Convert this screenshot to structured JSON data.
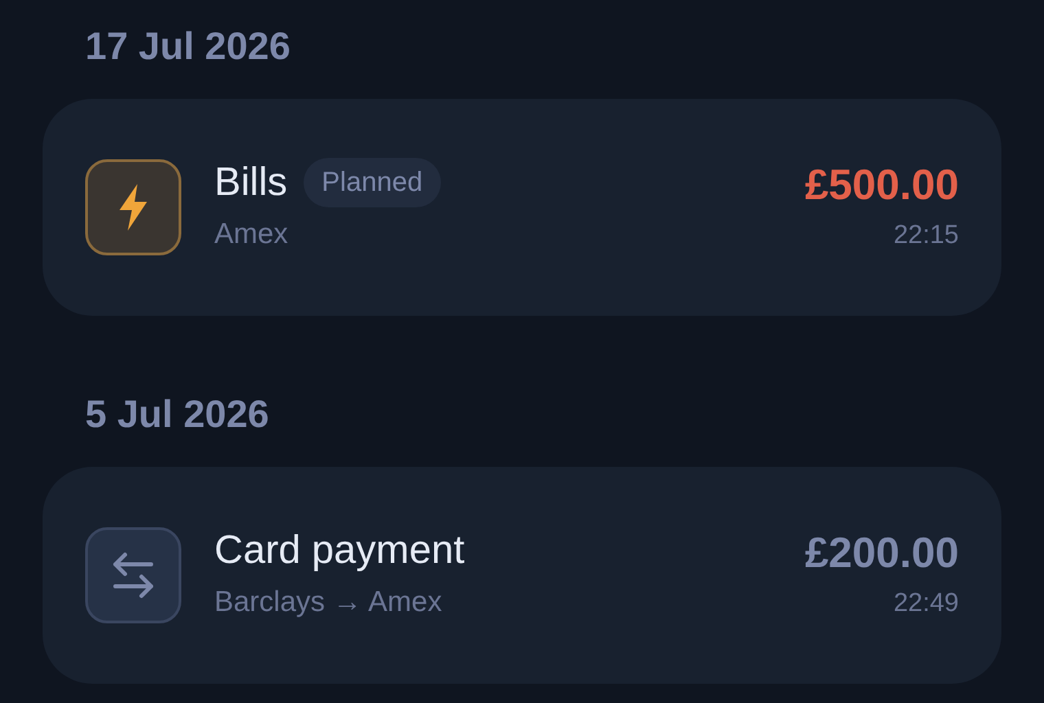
{
  "groups": [
    {
      "date": "17 Jul 2026",
      "transactions": [
        {
          "kind": "bill",
          "title": "Bills",
          "badge": "Planned",
          "account": "Amex",
          "amount": "£500.00",
          "time": "22:15"
        }
      ]
    },
    {
      "date": "5 Jul 2026",
      "transactions": [
        {
          "kind": "transfer",
          "title": "Card payment",
          "account": "Barclays → Amex",
          "amount": "£200.00",
          "time": "22:49"
        }
      ]
    }
  ]
}
